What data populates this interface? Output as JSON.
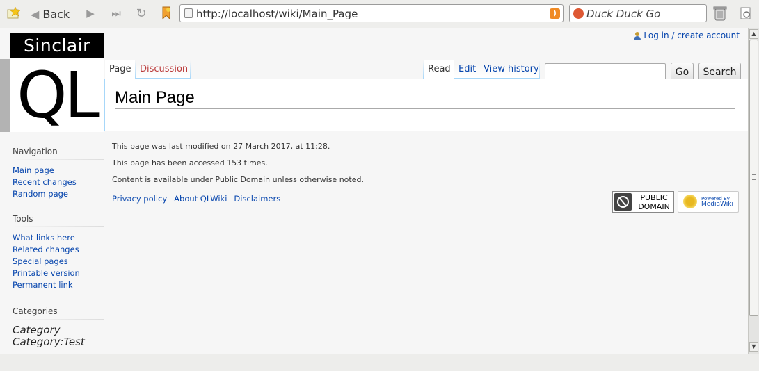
{
  "browser": {
    "back_label": "Back",
    "url": "http://localhost/wiki/Main_Page",
    "search_engine": "Duck Duck Go"
  },
  "logo": {
    "top_text": "Sinclair",
    "main_text": "QL"
  },
  "personal": {
    "login_label": "Log in / create account"
  },
  "tabs": {
    "page": "Page",
    "discussion": "Discussion",
    "read": "Read",
    "edit": "Edit",
    "view_history": "View history"
  },
  "search": {
    "go_label": "Go",
    "search_label": "Search",
    "value": ""
  },
  "content": {
    "title": "Main Page"
  },
  "sidebar": {
    "navigation": {
      "heading": "Navigation",
      "items": [
        "Main page",
        "Recent changes",
        "Random page"
      ]
    },
    "tools": {
      "heading": "Tools",
      "items": [
        "What links here",
        "Related changes",
        "Special pages",
        "Printable version",
        "Permanent link"
      ]
    },
    "categories": {
      "heading": "Categories",
      "items": [
        "Category",
        "Category:Test"
      ]
    }
  },
  "footer": {
    "last_modified": "This page was last modified on 27 March 2017, at 11:28.",
    "accessed": "This page has been accessed 153 times.",
    "license": "Content is available under Public Domain unless otherwise noted.",
    "links": [
      "Privacy policy",
      "About QLWiki",
      "Disclaimers"
    ],
    "badge_public_domain": "PUBLIC DOMAIN",
    "badge_powered_by": "Powered By",
    "badge_mediawiki": "MediaWiki"
  },
  "colors": {
    "link": "#0645ad",
    "new_link": "#ba3a3a",
    "tab_border": "#a7d7f9"
  }
}
